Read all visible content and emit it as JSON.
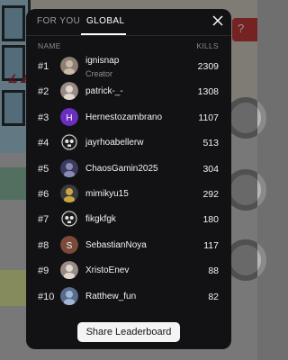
{
  "tabs": {
    "for_you": "FOR YOU",
    "global": "GLOBAL",
    "active": "global"
  },
  "columns": {
    "name": "NAME",
    "kills": "KILLS"
  },
  "leaderboard": [
    {
      "rank": "#1",
      "name": "ignisnap",
      "subtitle": "Creator",
      "kills": "2309",
      "avatar": "photo-avatar"
    },
    {
      "rank": "#2",
      "name": "patrick-_-",
      "kills": "1308",
      "avatar": "photo-avatar"
    },
    {
      "rank": "#3",
      "name": "Hernestozambrano",
      "kills": "1107",
      "avatar": "letter-avatar-h",
      "avatar_letter": "H",
      "avatar_color": "#6b2fbf"
    },
    {
      "rank": "#4",
      "name": "jayrhoabellerw",
      "kills": "513",
      "avatar": "skull-avatar"
    },
    {
      "rank": "#5",
      "name": "ChaosGamin2025",
      "kills": "304",
      "avatar": "photo-avatar"
    },
    {
      "rank": "#6",
      "name": "mimikyu15",
      "kills": "292",
      "avatar": "photo-avatar"
    },
    {
      "rank": "#7",
      "name": "fikgkfgk",
      "kills": "180",
      "avatar": "skull-avatar"
    },
    {
      "rank": "#8",
      "name": "SebastianNoya",
      "kills": "117",
      "avatar": "letter-avatar-s",
      "avatar_letter": "S",
      "avatar_color": "#7a4a3a"
    },
    {
      "rank": "#9",
      "name": "XristoEnev",
      "kills": "88",
      "avatar": "photo-avatar"
    },
    {
      "rank": "#10",
      "name": "Ratthew_fun",
      "kills": "82",
      "avatar": "photo-avatar"
    }
  ],
  "share_label": "Share Leaderboard",
  "icons": {
    "close": "close-icon"
  },
  "colors": {
    "panel_bg": "#121214",
    "button_bg": "#f4f4f4",
    "muted_text": "#8e8e8e"
  }
}
